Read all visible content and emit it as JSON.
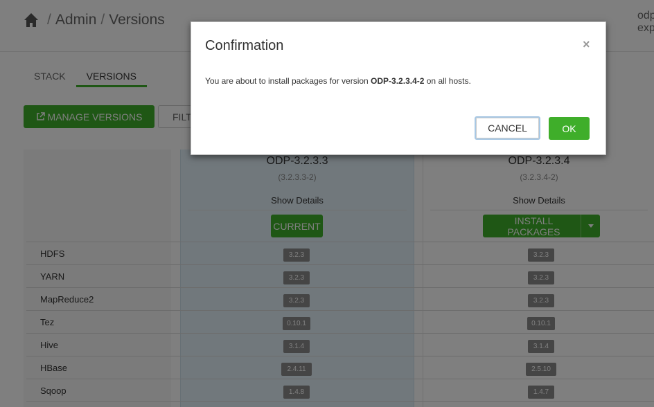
{
  "header": {
    "breadcrumb": [
      "Admin",
      "Versions"
    ],
    "separator": "/",
    "user_line1": "odp",
    "user_line2": "exp"
  },
  "tabs": [
    {
      "label": "STACK",
      "active": false
    },
    {
      "label": "VERSIONS",
      "active": true
    }
  ],
  "toolbar": {
    "manage_label": "MANAGE VERSIONS",
    "filter_label": "FILT"
  },
  "versions": [
    {
      "name": "ODP-3.2.3.3",
      "build": "(3.2.3.3-2)",
      "details_label": "Show Details",
      "action_label": "CURRENT"
    },
    {
      "name": "ODP-3.2.3.4",
      "build": "(3.2.3.4-2)",
      "details_label": "Show Details",
      "action_label": "INSTALL PACKAGES"
    }
  ],
  "services": [
    {
      "name": "HDFS",
      "v1": "3.2.3",
      "v2": "3.2.3"
    },
    {
      "name": "YARN",
      "v1": "3.2.3",
      "v2": "3.2.3"
    },
    {
      "name": "MapReduce2",
      "v1": "3.2.3",
      "v2": "3.2.3"
    },
    {
      "name": "Tez",
      "v1": "0.10.1",
      "v2": "0.10.1"
    },
    {
      "name": "Hive",
      "v1": "3.1.4",
      "v2": "3.1.4"
    },
    {
      "name": "HBase",
      "v1": "2.4.11",
      "v2": "2.5.10"
    },
    {
      "name": "Sqoop",
      "v1": "1.4.8",
      "v2": "1.4.7"
    }
  ],
  "modal": {
    "title": "Confirmation",
    "close": "×",
    "body_prefix": "You are about to install packages for version ",
    "body_version": "ODP-3.2.3.4-2",
    "body_suffix": " on all hosts.",
    "cancel_label": "CANCEL",
    "ok_label": "OK"
  },
  "colors": {
    "accent": "#3fae2a",
    "badge": "#8a8a8a",
    "current_col": "#e2f0f8"
  }
}
